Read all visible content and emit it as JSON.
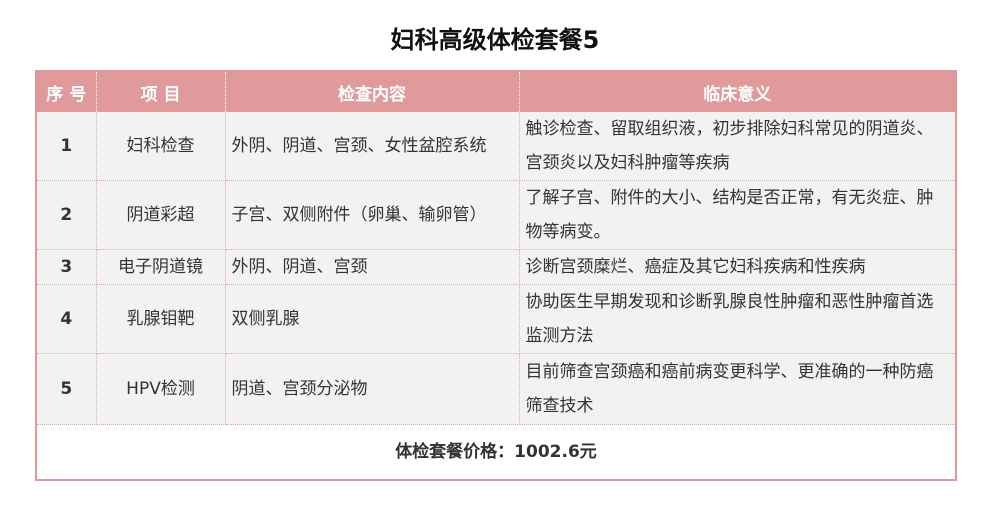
{
  "title": "妇科高级体检套餐5",
  "headers": {
    "no": "序 号",
    "item": "项 目",
    "content": "检查内容",
    "meaning": "临床意义"
  },
  "rows": [
    {
      "no": "1",
      "item": "妇科检查",
      "content": "外阴、阴道、宫颈、女性盆腔系统",
      "meaning": "触诊检查、留取组织液，初步排除妇科常见的阴道炎、宫颈炎以及妇科肿瘤等疾病"
    },
    {
      "no": "2",
      "item": "阴道彩超",
      "content": "子宫、双侧附件（卵巢、输卵管）",
      "meaning": "了解子宫、附件的大小、结构是否正常，有无炎症、肿物等病变。"
    },
    {
      "no": "3",
      "item": "电子阴道镜",
      "content": "外阴、阴道、宫颈",
      "meaning": "诊断宫颈糜烂、癌症及其它妇科疾病和性疾病"
    },
    {
      "no": "4",
      "item": "乳腺钼靶",
      "content": "双侧乳腺",
      "meaning": "协助医生早期发现和诊断乳腺良性肿瘤和恶性肿瘤首选监测方法"
    },
    {
      "no": "5",
      "item": "HPV检测",
      "content": "阴道、宫颈分泌物",
      "meaning": "目前筛查宫颈癌和癌前病变更科学、更准确的一种防癌筛查技术"
    }
  ],
  "footer": "体检套餐价格：1002.6元",
  "colors": {
    "header_bg": "#e09a9c",
    "row_bg": "#f2f2f2",
    "border": "#e0999b"
  }
}
